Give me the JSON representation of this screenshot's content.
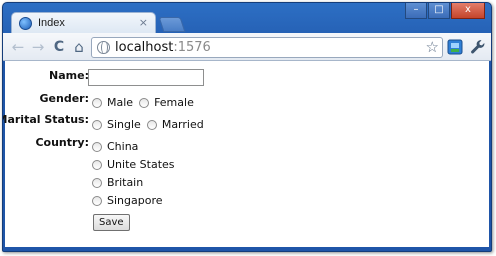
{
  "browser": {
    "tab_title": "Index",
    "tab_close": "×",
    "window_controls": {
      "minimize": "–",
      "maximize": "□",
      "close": "x"
    },
    "nav": {
      "back": "←",
      "forward": "→",
      "reload": "C",
      "home": "⌂"
    },
    "address": {
      "host": "localhost",
      "port": ":1576"
    },
    "bookmark_star": "☆"
  },
  "form": {
    "name_label": "Name:",
    "name_value": "",
    "gender_label": "Gender:",
    "gender_options": [
      "Male",
      "Female"
    ],
    "marital_label": "Marital Status:",
    "marital_options": [
      "Single",
      "Married"
    ],
    "country_label": "Country:",
    "country_options": [
      "China",
      "Unite States",
      "Britain",
      "Singapore"
    ],
    "save_label": "Save"
  }
}
